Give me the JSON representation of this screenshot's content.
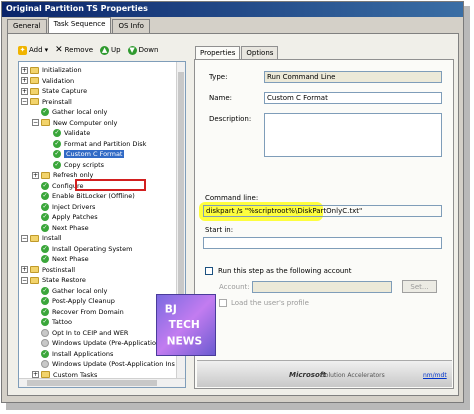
{
  "window": {
    "title": "Original Partition TS Properties"
  },
  "tabs": [
    {
      "label": "General"
    },
    {
      "label": "Task Sequence"
    },
    {
      "label": "OS Info"
    }
  ],
  "toolbar": {
    "add": "Add",
    "remove": "Remove",
    "up": "Up",
    "down": "Down"
  },
  "tree": {
    "items": [
      {
        "label": "Initialization",
        "icon": "folder-icon"
      },
      {
        "label": "Validation",
        "icon": "folder-icon"
      },
      {
        "label": "State Capture",
        "icon": "folder-icon"
      },
      {
        "label": "Preinstall",
        "icon": "folder-icon"
      },
      {
        "label": "Gather local only",
        "icon": "check-icon"
      },
      {
        "label": "New Computer only",
        "icon": "folder-icon"
      },
      {
        "label": "Validate",
        "icon": "check-icon"
      },
      {
        "label": "Format and Partition Disk",
        "icon": "check-icon"
      },
      {
        "label": "Custom C Format",
        "icon": "check-icon"
      },
      {
        "label": "Copy scripts",
        "icon": "check-icon"
      },
      {
        "label": "Refresh only",
        "icon": "folder-icon"
      },
      {
        "label": "Configure",
        "icon": "check-icon"
      },
      {
        "label": "Enable BitLocker (Offline)",
        "icon": "check-icon"
      },
      {
        "label": "Inject Drivers",
        "icon": "check-icon"
      },
      {
        "label": "Apply Patches",
        "icon": "check-icon"
      },
      {
        "label": "Next Phase",
        "icon": "check-icon"
      },
      {
        "label": "Install",
        "icon": "folder-icon"
      },
      {
        "label": "Install Operating System",
        "icon": "check-icon"
      },
      {
        "label": "Next Phase",
        "icon": "check-icon"
      },
      {
        "label": "Postinstall",
        "icon": "folder-icon"
      },
      {
        "label": "State Restore",
        "icon": "folder-icon"
      },
      {
        "label": "Gather local only",
        "icon": "check-icon"
      },
      {
        "label": "Post-Apply Cleanup",
        "icon": "check-icon"
      },
      {
        "label": "Recover From Domain",
        "icon": "check-icon"
      },
      {
        "label": "Tattoo",
        "icon": "check-icon"
      },
      {
        "label": "Opt In to CEIP and WER",
        "icon": "gray-icon"
      },
      {
        "label": "Windows Update (Pre-Application Ins",
        "icon": "gray-icon"
      },
      {
        "label": "Install Applications",
        "icon": "check-icon"
      },
      {
        "label": "Windows Update (Post-Application Ins",
        "icon": "gray-icon"
      },
      {
        "label": "Custom Tasks",
        "icon": "folder-icon"
      }
    ]
  },
  "props_tabs": [
    {
      "label": "Properties"
    },
    {
      "label": "Options"
    }
  ],
  "props": {
    "type_label": "Type:",
    "type_value": "Run Command Line",
    "name_label": "Name:",
    "name_value": "Custom C Format",
    "description_label": "Description:",
    "description_value": "",
    "cmd_label": "Command line:",
    "cmd_value": "diskpart /s \"%scriptroot%\\DiskPartOnlyC.txt\"",
    "startin_label": "Start in:",
    "startin_value": "",
    "run_as_label": "Run this step as the following account",
    "account_label": "Account:",
    "set_button": "Set...",
    "load_profile_label": "Load the user's profile"
  },
  "footer": {
    "microsoft": "Microsoft",
    "solution": "Solution Accelerators",
    "link": "nm/mdt"
  },
  "stamp": {
    "line1": "BJ",
    "line2": "TECH",
    "line3": "NEWS"
  },
  "colors": {
    "accent": "#316ac5",
    "highlight": "#ffff00",
    "selection_box": "#d21f1f",
    "check_green": "#3aa63a"
  }
}
